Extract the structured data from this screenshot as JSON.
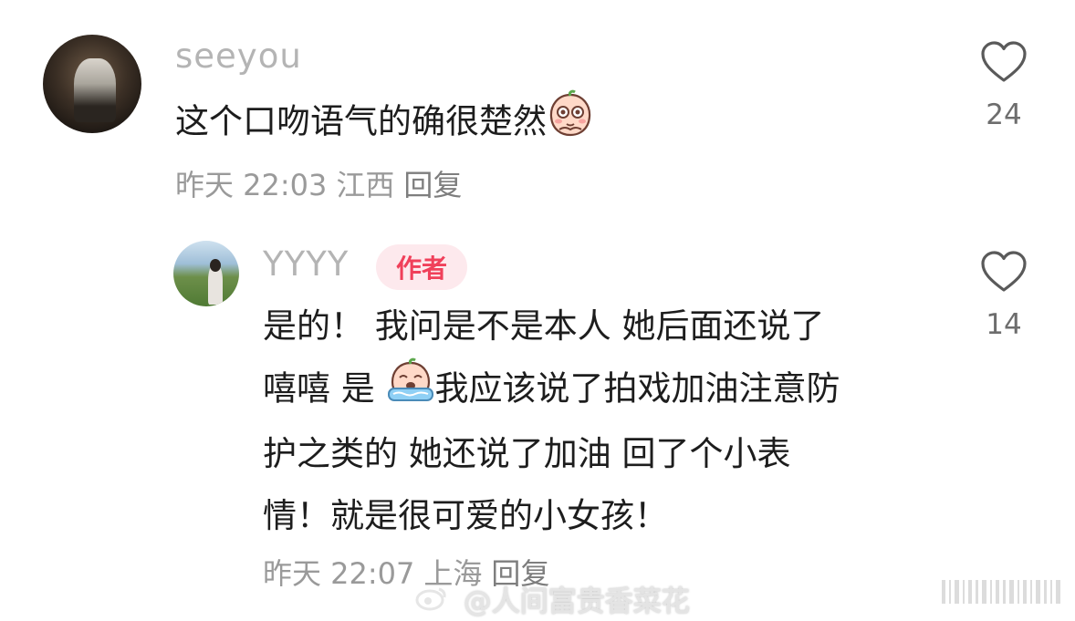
{
  "comment1": {
    "username": "seeyou",
    "text": "这个口吻语气的确很楚然",
    "time": "昨天 22:03",
    "location": "江西",
    "reply_label": "回复",
    "likes": "24"
  },
  "comment2": {
    "username": "YYYY",
    "badge": "作者",
    "line1": "是的！ 我问是不是本人 她后面还说了",
    "line2a": "嘻嘻 是",
    "line2b": "我应该说了拍戏加油注意防",
    "line3": "护之类的 她还说了加油 回了个小表",
    "line4": "情！就是很可爱的小女孩！",
    "time": "昨天 22:07",
    "location": "上海",
    "reply_label": "回复",
    "likes": "14"
  },
  "watermark": {
    "text": "@人间富贵香菜花",
    "logo": "微博"
  },
  "colors": {
    "username": "#b4b4b4",
    "badge_bg": "#fde9ed",
    "badge_text": "#f0405a",
    "meta": "#9a9a9a"
  },
  "icons": [
    "heart-outline-icon",
    "blushing-peach-emoji",
    "crying-peach-emoji"
  ]
}
